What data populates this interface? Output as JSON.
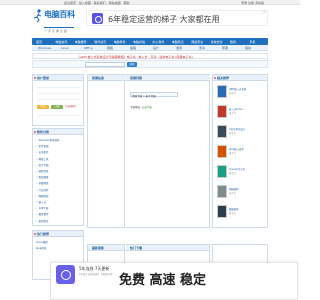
{
  "topbar": {
    "left": "设为首页 · 加入收藏 · 联系我们 · 网站地图 · 帮助",
    "right": "登录 注册 手机版"
  },
  "logo": {
    "brand": "电脑百科",
    "slogan": "一 手 掌 握 全 面"
  },
  "ad_top": {
    "text": "6年稳定运营的梯子 大家都在用",
    "mark": "广告"
  },
  "nav": [
    "首页",
    "电脑资讯",
    "电脑硬件",
    "软件资讯",
    "电脑软件",
    "电脑系统",
    "办公软件",
    "电脑知识",
    "网络安全",
    "系统优化",
    "数码",
    "手机"
  ],
  "subnav": [
    "Windows",
    "Linux",
    "Office",
    "网络",
    "编程",
    "设计",
    "游戏",
    "安卓",
    "苹果",
    "驱动"
  ],
  "banner": {
    "text": "《ARM 嵌入式系统设计与编程教程》电子书 · 嵌入式 · 高清 · 最新电子书 [经典电子书]"
  },
  "search": {
    "button": "搜索"
  },
  "left_panel_1": {
    "title": "用户登录",
    "btn1": "登录",
    "btn2": "注册",
    "note": "忘记密码?"
  },
  "left_panel_2": {
    "title": "软件分类",
    "items": [
      "Windows系统软件",
      "文件管理",
      "安全相关",
      "网络工具",
      "电子书籍",
      "编程开发",
      "图形图像",
      "多媒体类",
      "行业软件",
      "网络游戏",
      "输入法",
      "字体下载",
      "教育教学",
      "驱动程序"
    ]
  },
  "left_panel_3": {
    "title": "热门推荐",
    "items": [
      "Linux编程",
      "Java开发"
    ]
  },
  "mid_left": {
    "title": "资源信息"
  },
  "mid_right": {
    "title": "资源列表",
    "crumb": "资源下载 > 电子书籍",
    "status_prefix": "下载地址:",
    "status_link": "点击下载"
  },
  "right_panel": {
    "title": "相关推荐",
    "books": [
      {
        "title": "ARM嵌入式系统",
        "sub": "电子书"
      },
      {
        "title": "嵌入式Linux",
        "sub": "电子书"
      },
      {
        "title": "C语言程序设计",
        "sub": "电子书"
      },
      {
        "title": "Java核心技术",
        "sub": "电子书"
      },
      {
        "title": "Linux命令大全",
        "sub": "电子书"
      },
      {
        "title": "网络编程",
        "sub": "电子书"
      },
      {
        "title": "数据结构",
        "sub": "电子书"
      }
    ]
  },
  "bottom": {
    "left_title": "最新更新",
    "mid_title": "热门下载"
  },
  "ad_bottom": {
    "head": "5年连线 7天更新",
    "sub": "6年稳定运营的梯子 大家都在用",
    "big": "免费 高速 稳定"
  },
  "colors": {
    "nav": "#1e6fbe",
    "panel_head": "#e8f1fa",
    "ad_icon": "#5a55e6"
  }
}
